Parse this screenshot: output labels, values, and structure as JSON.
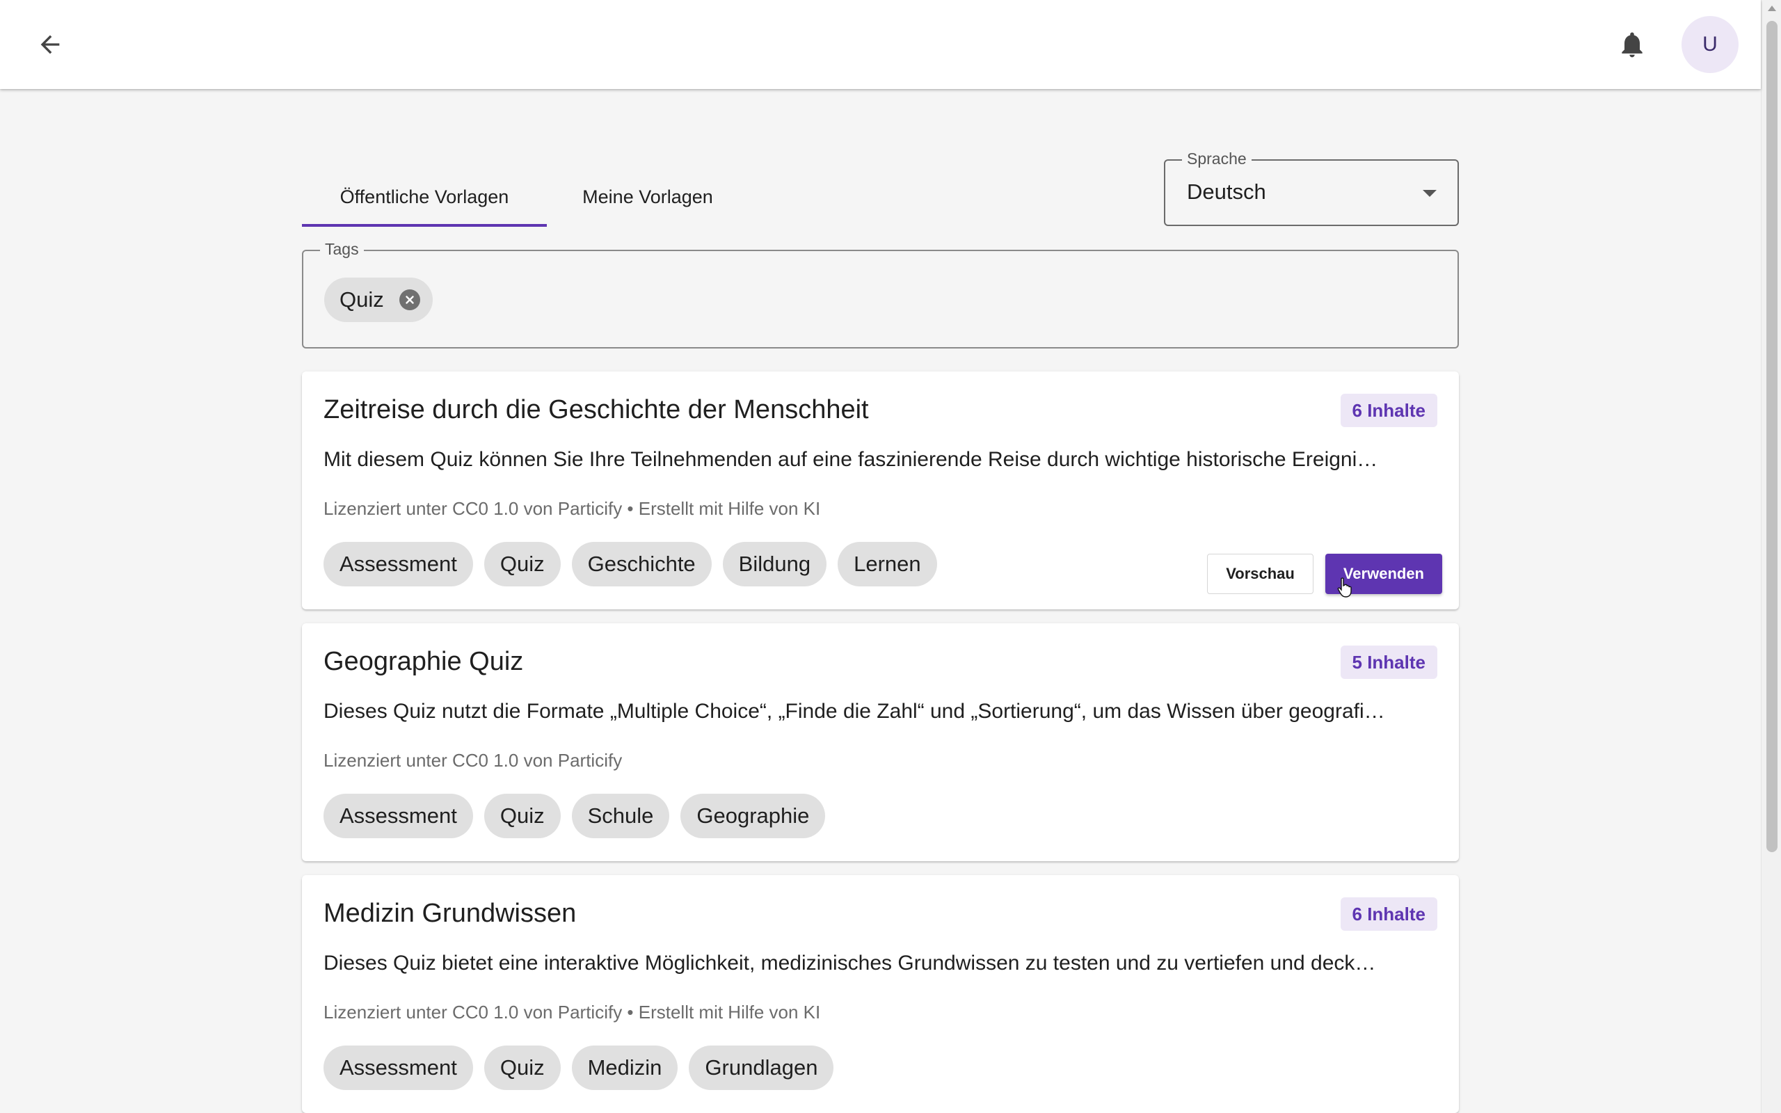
{
  "header": {
    "back_icon": "arrow-left-icon",
    "notifications_icon": "bell-icon",
    "avatar_initial": "U"
  },
  "tabs": [
    {
      "label": "Öffentliche Vorlagen",
      "active": true
    },
    {
      "label": "Meine Vorlagen",
      "active": false
    }
  ],
  "language": {
    "label": "Sprache",
    "value": "Deutsch"
  },
  "tags_filter": {
    "label": "Tags",
    "selected": [
      "Quiz"
    ]
  },
  "colors": {
    "accent": "#5e35b1",
    "badge_bg": "#ede7f6",
    "chip_bg": "#e0e0e0"
  },
  "templates": [
    {
      "title": "Zeitreise durch die Geschichte der Menschheit",
      "count": "6 Inhalte",
      "description": "Mit diesem Quiz können Sie Ihre Teilnehmenden auf eine faszinierende Reise durch wichtige historische Ereigni…",
      "license": "Lizenziert unter CC0 1.0 von Particify • Erstellt mit Hilfe von KI",
      "tags": [
        "Assessment",
        "Quiz",
        "Geschichte",
        "Bildung",
        "Lernen"
      ],
      "actions": {
        "preview": "Vorschau",
        "use": "Verwenden"
      }
    },
    {
      "title": "Geographie Quiz",
      "count": "5 Inhalte",
      "description": "Dieses Quiz nutzt die Formate „Multiple Choice“, „Finde die Zahl“ und „Sortierung“, um das Wissen über geografi…",
      "license": "Lizenziert unter CC0 1.0 von Particify",
      "tags": [
        "Assessment",
        "Quiz",
        "Schule",
        "Geographie"
      ]
    },
    {
      "title": "Medizin Grundwissen",
      "count": "6 Inhalte",
      "description": "Dieses Quiz bietet eine interaktive Möglichkeit, medizinisches Grundwissen zu testen und zu vertiefen und deck…",
      "license": "Lizenziert unter CC0 1.0 von Particify • Erstellt mit Hilfe von KI",
      "tags": [
        "Assessment",
        "Quiz",
        "Medizin",
        "Grundlagen"
      ]
    }
  ]
}
